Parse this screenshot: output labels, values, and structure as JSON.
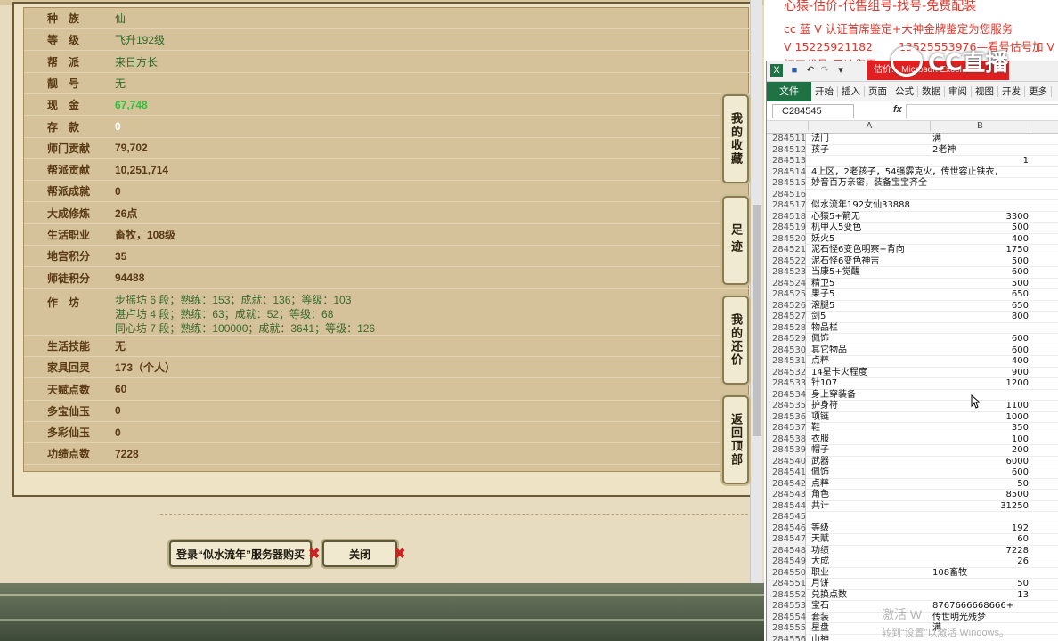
{
  "game": {
    "rows": [
      {
        "k": "种　族",
        "v": "仙",
        "style": "green"
      },
      {
        "k": "等　级",
        "v": "飞升192级",
        "style": "green"
      },
      {
        "k": "帮　派",
        "v": "来日方长",
        "style": "green"
      },
      {
        "k": "靓　号",
        "v": "无",
        "style": "green"
      },
      {
        "k": "现　金",
        "v": "67,748",
        "style": "bright"
      },
      {
        "k": "存　款",
        "v": "0",
        "style": "white"
      },
      {
        "k": "师门贡献",
        "v": "79,702",
        "style": "dark"
      },
      {
        "k": "帮派贡献",
        "v": "10,251,714",
        "style": "dark"
      },
      {
        "k": "帮派成就",
        "v": "0",
        "style": "dark"
      },
      {
        "k": "大成修炼",
        "v": "26点",
        "style": "dark"
      },
      {
        "k": "生活职业",
        "v": "畜牧，108级",
        "style": "dark"
      },
      {
        "k": "地宫积分",
        "v": "35",
        "style": "dark"
      },
      {
        "k": "师徒积分",
        "v": "94488",
        "style": "dark"
      }
    ],
    "workshop": {
      "k": "作　坊",
      "lines": [
        "步摇坊 6 段；熟练：153；成就：136；等级：103",
        "湛卢坊 4 段；熟练：63；成就：52；等级：68",
        "同心坊 7 段；熟练：100000；成就：3641；等级：126"
      ]
    },
    "rows2": [
      {
        "k": "生活技能",
        "v": "无",
        "style": "dark"
      },
      {
        "k": "家具回灵",
        "v": "173（个人）",
        "style": "dark"
      },
      {
        "k": "天赋点数",
        "v": "60",
        "style": "dark"
      },
      {
        "k": "多宝仙玉",
        "v": "0",
        "style": "dark"
      },
      {
        "k": "多彩仙玉",
        "v": "0",
        "style": "dark"
      },
      {
        "k": "功绩点数",
        "v": "7228",
        "style": "dark"
      }
    ],
    "sidetabs": [
      {
        "label": "我的收藏"
      },
      {
        "label": "足迹"
      },
      {
        "label": "我的还价"
      },
      {
        "label": "返回顶部"
      }
    ],
    "buttons": {
      "login": "登录“似水流年”服务器购买",
      "close": "关闭"
    }
  },
  "overlay": {
    "line0": "心猿-估价-代售组号-找号-免费配装",
    "line1": "cc 蓝 V 认证首席鉴定+大神金牌鉴定为您服务",
    "line2": "V 15225921182 　　13525553976—看号估号加 V",
    "line3": "打工代号-无论您需..."
  },
  "excel": {
    "namebox": "C284545",
    "redbar": "估价... Microsoft Excel",
    "file_tab": "文件",
    "tabs": [
      "开始",
      "插入",
      "页面",
      "公式",
      "数据",
      "审阅",
      "视图",
      "开发",
      "更多"
    ],
    "col_a": "A",
    "col_b": "B",
    "rows": [
      {
        "n": "284511",
        "a": "法门",
        "b": "满"
      },
      {
        "n": "284512",
        "a": "孩子",
        "b": "2老神"
      },
      {
        "n": "284513",
        "a": "",
        "b": "1",
        "bnum": true
      },
      {
        "n": "284514",
        "a": "4上区，2老孩子，54强霹克火，传世容止铁衣，",
        "b": ""
      },
      {
        "n": "284515",
        "a": "妙音百万亲密，装备宝宝齐全",
        "b": ""
      },
      {
        "n": "284516",
        "a": "",
        "b": ""
      },
      {
        "n": "284517",
        "a": "似水流年192女仙33888",
        "b": ""
      },
      {
        "n": "284518",
        "a": "心猿5+箭无",
        "b": "3300",
        "bnum": true
      },
      {
        "n": "284519",
        "a": "机甲人5变色",
        "b": "500",
        "bnum": true
      },
      {
        "n": "284520",
        "a": "妖火5",
        "b": "400",
        "bnum": true
      },
      {
        "n": "284521",
        "a": "泥石怪6变色明察+背向",
        "b": "1750",
        "bnum": true
      },
      {
        "n": "284522",
        "a": "泥石怪6变色神吉",
        "b": "500",
        "bnum": true
      },
      {
        "n": "284523",
        "a": "当康5+觉醒",
        "b": "600",
        "bnum": true
      },
      {
        "n": "284524",
        "a": "精卫5",
        "b": "500",
        "bnum": true
      },
      {
        "n": "284525",
        "a": "果子5",
        "b": "650",
        "bnum": true
      },
      {
        "n": "284526",
        "a": "滚腿5",
        "b": "650",
        "bnum": true
      },
      {
        "n": "284527",
        "a": "剑5",
        "b": "800",
        "bnum": true
      },
      {
        "n": "284528",
        "a": "物品栏",
        "b": ""
      },
      {
        "n": "284529",
        "a": "佩饰",
        "b": "600",
        "bnum": true
      },
      {
        "n": "284530",
        "a": "其它物品",
        "b": "600",
        "bnum": true
      },
      {
        "n": "284531",
        "a": "点粹",
        "b": "400",
        "bnum": true
      },
      {
        "n": "284532",
        "a": "14星卡火程度",
        "b": "900",
        "bnum": true
      },
      {
        "n": "284533",
        "a": "针107",
        "b": "1200",
        "bnum": true
      },
      {
        "n": "284534",
        "a": "身上穿装备",
        "b": ""
      },
      {
        "n": "284535",
        "a": "护身符",
        "b": "1100",
        "bnum": true
      },
      {
        "n": "284536",
        "a": "项链",
        "b": "1000",
        "bnum": true
      },
      {
        "n": "284537",
        "a": "鞋",
        "b": "350",
        "bnum": true
      },
      {
        "n": "284538",
        "a": "衣服",
        "b": "100",
        "bnum": true
      },
      {
        "n": "284539",
        "a": "帽子",
        "b": "200",
        "bnum": true
      },
      {
        "n": "284540",
        "a": "武器",
        "b": "6000",
        "bnum": true
      },
      {
        "n": "284541",
        "a": "佩饰",
        "b": "600",
        "bnum": true
      },
      {
        "n": "284542",
        "a": "点粹",
        "b": "50",
        "bnum": true
      },
      {
        "n": "284543",
        "a": "角色",
        "b": "8500",
        "bnum": true
      },
      {
        "n": "284544",
        "a": "共计",
        "b": "31250",
        "bnum": true
      },
      {
        "n": "284545",
        "a": "",
        "b": ""
      },
      {
        "n": "284546",
        "a": "等级",
        "b": "192",
        "bnum": true
      },
      {
        "n": "284547",
        "a": "天赋",
        "b": "60",
        "bnum": true
      },
      {
        "n": "284548",
        "a": "功绩",
        "b": "7228",
        "bnum": true
      },
      {
        "n": "284549",
        "a": "大成",
        "b": "26",
        "bnum": true
      },
      {
        "n": "284550",
        "a": "职业",
        "b": "108畜牧"
      },
      {
        "n": "284551",
        "a": "月饼",
        "b": "50",
        "bnum": true
      },
      {
        "n": "284552",
        "a": "兑换点数",
        "b": "13",
        "bnum": true
      },
      {
        "n": "284553",
        "a": "宝石",
        "b": "8767666668666+"
      },
      {
        "n": "284554",
        "a": "套装",
        "b": "传世明光残梦"
      },
      {
        "n": "284555",
        "a": "星盘",
        "b": "满"
      },
      {
        "n": "284556",
        "a": "山神",
        "b": ""
      }
    ]
  },
  "logo": "CC直播",
  "watermark": {
    "line1": "激活 W",
    "line2": "转到“设置”以激活 Windows。"
  }
}
